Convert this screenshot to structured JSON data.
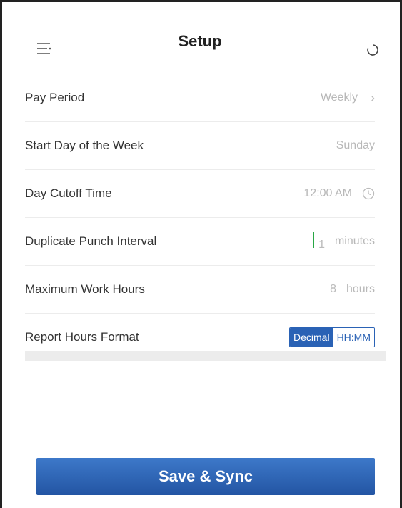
{
  "header": {
    "title": "Setup"
  },
  "settings": {
    "pay_period": {
      "label": "Pay Period",
      "value": "Weekly"
    },
    "start_day": {
      "label": "Start Day of the Week",
      "value": "Sunday"
    },
    "cutoff": {
      "label": "Day Cutoff Time",
      "value": "12:00 AM"
    },
    "duplicate": {
      "label": "Duplicate Punch Interval",
      "value": "1",
      "unit": "minutes"
    },
    "max_hours": {
      "label": "Maximum Work Hours",
      "value": "8",
      "unit": "hours"
    },
    "report_format": {
      "label": "Report Hours Format",
      "options": [
        "Decimal",
        "HH:MM"
      ],
      "selected": "Decimal"
    }
  },
  "actions": {
    "save_label": "Save & Sync"
  },
  "colors": {
    "accent": "#2a62b5",
    "button_top": "#3d78c9",
    "button_bottom": "#2355a3",
    "cursor": "#28a745"
  }
}
